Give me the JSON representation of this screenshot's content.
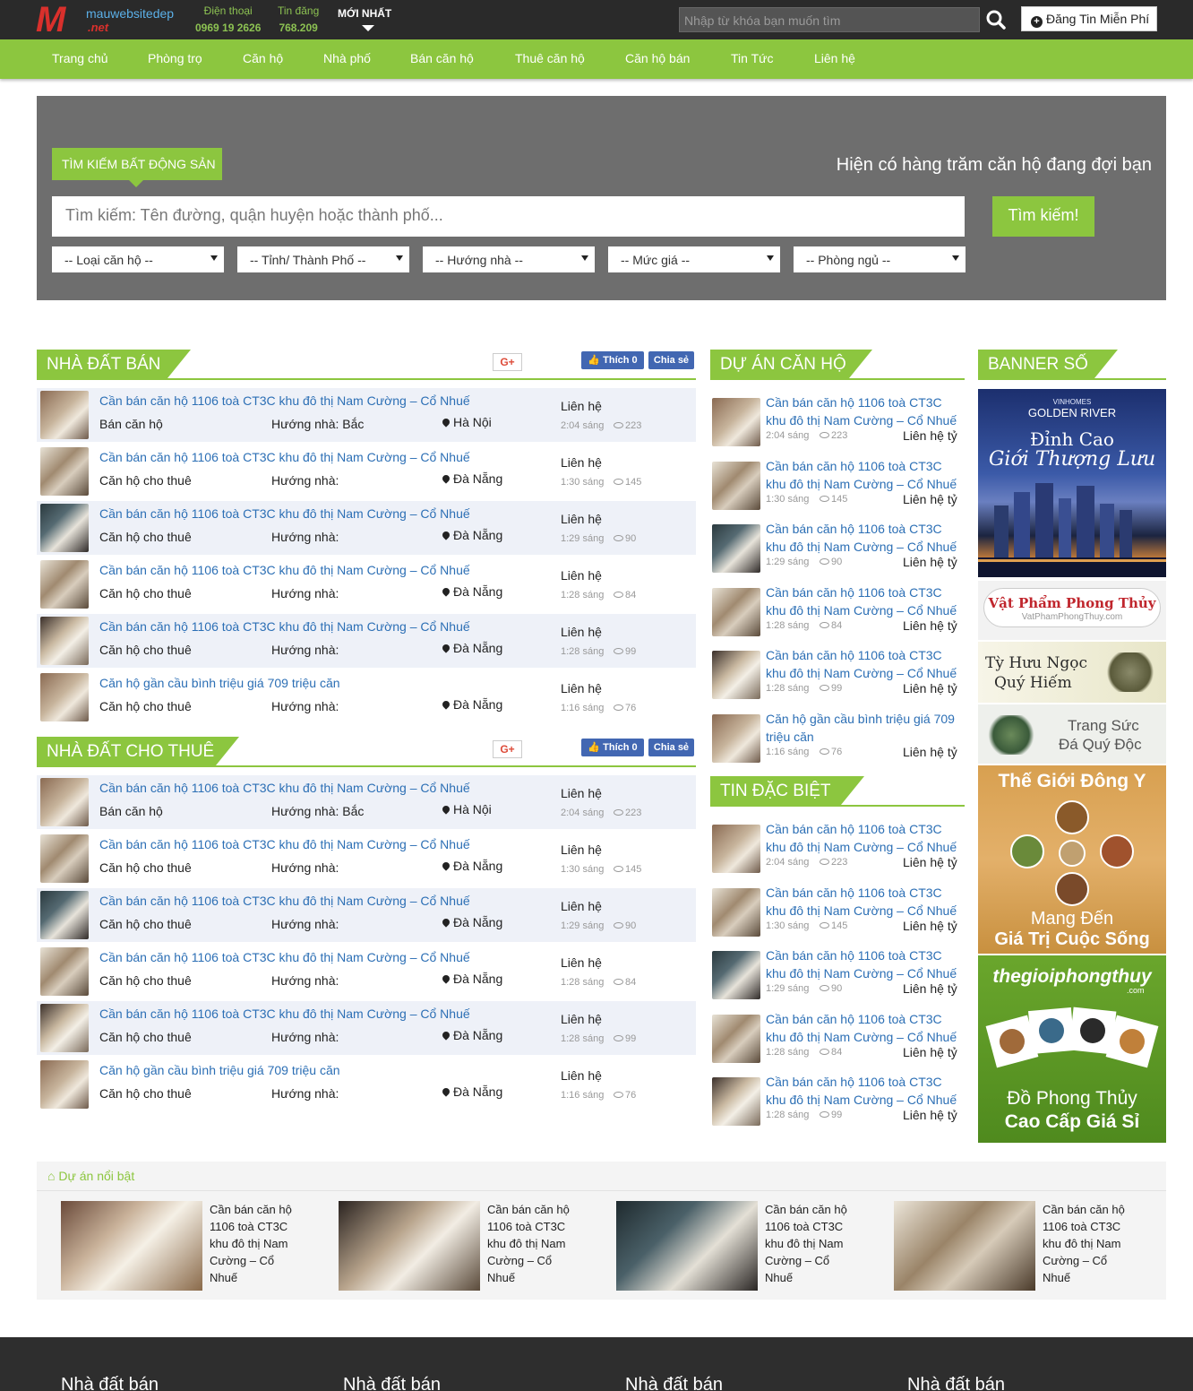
{
  "topbar": {
    "logo_text": "mauwebsitedep",
    "logo_sub": ".net",
    "phone_label": "Điện thoại",
    "phone_value": "0969 19 2626",
    "posts_label": "Tin đăng",
    "posts_value": "768.209",
    "newest_label": "MỚI NHẤT",
    "search_placeholder": "Nhập từ khóa bạn muốn tìm",
    "post_button": "Đăng Tin Miễn Phí"
  },
  "nav": [
    "Trang chủ",
    "Phòng trọ",
    "Căn hộ",
    "Nhà phố",
    "Bán căn hộ",
    "Thuê căn hộ",
    "Căn hộ bán",
    "Tin Tức",
    "Liên hệ"
  ],
  "search": {
    "tag": "TÌM KIẾM BẤT ĐỘNG SẢN",
    "slogan": "Hiện có hàng trăm căn hộ đang đợi bạn",
    "placeholder": "Tìm kiếm: Tên đường, quận huyện hoặc thành phố...",
    "button": "Tìm kiếm!",
    "filters": [
      "-- Loại căn hộ --",
      "-- Tỉnh/ Thành Phố --",
      "-- Hướng nhà --",
      "-- Mức giá --",
      "-- Phòng ngủ --"
    ]
  },
  "social": {
    "gplus": "G+",
    "like": "Thích 0",
    "share": "Chia sẻ"
  },
  "sale": {
    "title": "NHÀ ĐẤT BÁN",
    "rows": [
      {
        "title": "Cần bán căn hộ 1106 toà CT3C khu đô thị Nam Cường – Cổ Nhuế",
        "kind": "Bán căn hộ",
        "dir": "Hướng nhà: Bắc",
        "loc": "Hà Nội",
        "price": "Liên hệ",
        "time": "2:04 sáng",
        "views": "223"
      },
      {
        "title": "Cần bán căn hộ 1106 toà CT3C khu đô thị Nam Cường – Cổ Nhuế",
        "kind": "Căn hộ cho thuê",
        "dir": "Hướng nhà:",
        "loc": "Đà Nẵng",
        "price": "Liên hệ",
        "time": "1:30 sáng",
        "views": "145"
      },
      {
        "title": "Cần bán căn hộ 1106 toà CT3C khu đô thị Nam Cường – Cổ Nhuế",
        "kind": "Căn hộ cho thuê",
        "dir": "Hướng nhà:",
        "loc": "Đà Nẵng",
        "price": "Liên hệ",
        "time": "1:29 sáng",
        "views": "90"
      },
      {
        "title": "Cần bán căn hộ 1106 toà CT3C khu đô thị Nam Cường – Cổ Nhuế",
        "kind": "Căn hộ cho thuê",
        "dir": "Hướng nhà:",
        "loc": "Đà Nẵng",
        "price": "Liên hệ",
        "time": "1:28 sáng",
        "views": "84"
      },
      {
        "title": "Cần bán căn hộ 1106 toà CT3C khu đô thị Nam Cường – Cổ Nhuế",
        "kind": "Căn hộ cho thuê",
        "dir": "Hướng nhà:",
        "loc": "Đà Nẵng",
        "price": "Liên hệ",
        "time": "1:28 sáng",
        "views": "99"
      },
      {
        "title": "Căn hộ gần cầu bình triệu giá 709 triệu căn",
        "kind": "Căn hộ cho thuê",
        "dir": "Hướng nhà:",
        "loc": "Đà Nẵng",
        "price": "Liên hệ",
        "time": "1:16 sáng",
        "views": "76"
      }
    ]
  },
  "rent": {
    "title": "NHÀ ĐẤT CHO THUÊ",
    "rows": [
      {
        "title": "Cần bán căn hộ 1106 toà CT3C khu đô thị Nam Cường – Cổ Nhuế",
        "kind": "Bán căn hộ",
        "dir": "Hướng nhà: Bắc",
        "loc": "Hà Nội",
        "price": "Liên hệ",
        "time": "2:04 sáng",
        "views": "223"
      },
      {
        "title": "Cần bán căn hộ 1106 toà CT3C khu đô thị Nam Cường – Cổ Nhuế",
        "kind": "Căn hộ cho thuê",
        "dir": "Hướng nhà:",
        "loc": "Đà Nẵng",
        "price": "Liên hệ",
        "time": "1:30 sáng",
        "views": "145"
      },
      {
        "title": "Cần bán căn hộ 1106 toà CT3C khu đô thị Nam Cường – Cổ Nhuế",
        "kind": "Căn hộ cho thuê",
        "dir": "Hướng nhà:",
        "loc": "Đà Nẵng",
        "price": "Liên hệ",
        "time": "1:29 sáng",
        "views": "90"
      },
      {
        "title": "Cần bán căn hộ 1106 toà CT3C khu đô thị Nam Cường – Cổ Nhuế",
        "kind": "Căn hộ cho thuê",
        "dir": "Hướng nhà:",
        "loc": "Đà Nẵng",
        "price": "Liên hệ",
        "time": "1:28 sáng",
        "views": "84"
      },
      {
        "title": "Cần bán căn hộ 1106 toà CT3C khu đô thị Nam Cường – Cổ Nhuế",
        "kind": "Căn hộ cho thuê",
        "dir": "Hướng nhà:",
        "loc": "Đà Nẵng",
        "price": "Liên hệ",
        "time": "1:28 sáng",
        "views": "99"
      },
      {
        "title": "Căn hộ gần cầu bình triệu giá 709 triệu căn",
        "kind": "Căn hộ cho thuê",
        "dir": "Hướng nhà:",
        "loc": "Đà Nẵng",
        "price": "Liên hệ",
        "time": "1:16 sáng",
        "views": "76"
      }
    ]
  },
  "projects": {
    "title": "DỰ ÁN CĂN HỘ",
    "rows": [
      {
        "title": "Cần bán căn hộ 1106 toà CT3C khu đô thị Nam Cường – Cổ Nhuế",
        "time": "2:04 sáng",
        "views": "223",
        "price": "Liên hệ tỷ"
      },
      {
        "title": "Cần bán căn hộ 1106 toà CT3C khu đô thị Nam Cường – Cổ Nhuế",
        "time": "1:30 sáng",
        "views": "145",
        "price": "Liên hệ tỷ"
      },
      {
        "title": "Cần bán căn hộ 1106 toà CT3C khu đô thị Nam Cường – Cổ Nhuế",
        "time": "1:29 sáng",
        "views": "90",
        "price": "Liên hệ tỷ"
      },
      {
        "title": "Cần bán căn hộ 1106 toà CT3C khu đô thị Nam Cường – Cổ Nhuế",
        "time": "1:28 sáng",
        "views": "84",
        "price": "Liên hệ tỷ"
      },
      {
        "title": "Cần bán căn hộ 1106 toà CT3C khu đô thị Nam Cường – Cổ Nhuế",
        "time": "1:28 sáng",
        "views": "99",
        "price": "Liên hệ tỷ"
      },
      {
        "title": "Căn hộ gần cầu bình triệu giá 709 triệu căn",
        "time": "1:16 sáng",
        "views": "76",
        "price": "Liên hệ tỷ"
      }
    ]
  },
  "special": {
    "title": "TIN ĐẶC BIỆT",
    "rows": [
      {
        "title": "Cần bán căn hộ 1106 toà CT3C khu đô thị Nam Cường – Cổ Nhuế",
        "time": "2:04 sáng",
        "views": "223",
        "price": "Liên hệ tỷ"
      },
      {
        "title": "Cần bán căn hộ 1106 toà CT3C khu đô thị Nam Cường – Cổ Nhuế",
        "time": "1:30 sáng",
        "views": "145",
        "price": "Liên hệ tỷ"
      },
      {
        "title": "Cần bán căn hộ 1106 toà CT3C khu đô thị Nam Cường – Cổ Nhuế",
        "time": "1:29 sáng",
        "views": "90",
        "price": "Liên hệ tỷ"
      },
      {
        "title": "Cần bán căn hộ 1106 toà CT3C khu đô thị Nam Cường – Cổ Nhuế",
        "time": "1:28 sáng",
        "views": "84",
        "price": "Liên hệ tỷ"
      },
      {
        "title": "Cần bán căn hộ 1106 toà CT3C khu đô thị Nam Cường – Cổ Nhuế",
        "time": "1:28 sáng",
        "views": "99",
        "price": "Liên hệ tỷ"
      }
    ]
  },
  "banners": {
    "title": "BANNER SỐ",
    "b1_brand": "VINHOMES",
    "b1_name": "GOLDEN RIVER",
    "b1_l1": "Đỉnh Cao",
    "b1_l2": "Giới Thượng Lưu",
    "b2_l1": "Vật Phẩm Phong Thủy",
    "b2_l2": "VatPhamPhongThuy.com",
    "b3_l1": "Tỳ Hưu Ngọc",
    "b3_l2": "Quý Hiếm",
    "b4_l1": "Trang Sức",
    "b4_l2": "Đá Quý Độc",
    "b5_l1": "Thế Giới Đông Y",
    "b5_l2": "Mang Đến",
    "b5_l3": "Giá Trị Cuộc Sống",
    "b6_l1": "thegioiphongthuy",
    "b6_l2": ".com",
    "b6_l3": "Đồ Phong Thủy",
    "b6_l4": "Cao Cấp Giá Sỉ"
  },
  "featured": {
    "title": "Dự án nổi bật",
    "items": [
      {
        "caption": "Cần bán căn hộ 1106 toà CT3C khu đô thị Nam Cường – Cổ Nhuế"
      },
      {
        "caption": "Cần bán căn hộ 1106 toà CT3C khu đô thị Nam Cường – Cổ Nhuế"
      },
      {
        "caption": "Cần bán căn hộ 1106 toà CT3C khu đô thị Nam Cường – Cổ Nhuế"
      },
      {
        "caption": "Cần bán căn hộ 1106 toà CT3C khu đô thị Nam Cường – Cổ Nhuế"
      }
    ]
  },
  "footer": [
    "Nhà đất bán",
    "Nhà đất bán",
    "Nhà đất bán",
    "Nhà đất bán"
  ]
}
